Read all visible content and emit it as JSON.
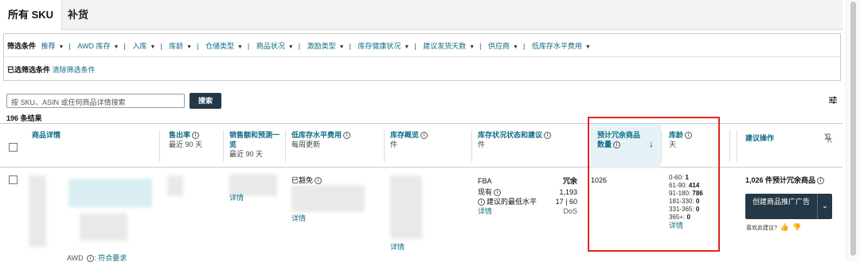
{
  "tabs": {
    "active": "所有 SKU",
    "other": "补货"
  },
  "filters": {
    "label": "筛选条件",
    "items": [
      "推荐",
      "AWD 库存",
      "入库",
      "库龄",
      "仓储类型",
      "商品状况",
      "激励类型",
      "库存健康状况",
      "建议发货天数",
      "供应商",
      "低库存水平费用"
    ],
    "selected_label": "已选筛选条件",
    "clear_label": "清除筛选条件"
  },
  "search": {
    "placeholder": "按 SKU、ASIN 或任何商品详情搜索",
    "button": "搜索"
  },
  "results_count": "196 条结果",
  "columns": {
    "product": "商品详情",
    "sell_through": {
      "title": "售出率",
      "sub": "最近 90 天"
    },
    "sales": {
      "title": "销售额和预测一览",
      "sub": "最近 90 天"
    },
    "low_fee": {
      "title": "低库存水平费用",
      "sub": "每周更新"
    },
    "overview": {
      "title": "库存概览",
      "sub": "件"
    },
    "health": {
      "title": "库存状况状态和建议",
      "sub": "件"
    },
    "excess": {
      "title": "预计冗余商品数量"
    },
    "age": {
      "title": "库龄",
      "sub": "天"
    },
    "action": {
      "title": "建议操作"
    }
  },
  "row": {
    "awd_label": "AWD",
    "awd_status": "符合要求",
    "sales_details": "详情",
    "exempt": "已豁免",
    "low_fee_details": "详情",
    "overview_details": "详情",
    "fba_label": "FBA",
    "status": "冗余",
    "available_label": "现有",
    "available_value": "1,193",
    "min_level_label": "建议的最低水平",
    "min_level_value": "17 | 60",
    "dos_label": "DoS",
    "health_details": "详情",
    "excess_value": "1026",
    "age_ranges": [
      {
        "range": "0-60:",
        "value": "1"
      },
      {
        "range": "61-90:",
        "value": "414"
      },
      {
        "range": "91-180:",
        "value": "786"
      },
      {
        "range": "181-330:",
        "value": "0"
      },
      {
        "range": "331-365:",
        "value": "0"
      },
      {
        "range": "365+:",
        "value": "0"
      }
    ],
    "age_details": "详情",
    "action_summary": "1,026 件预计冗余商品",
    "cta": "创建商品推广广告",
    "helpful": "喜欢此建议?"
  }
}
